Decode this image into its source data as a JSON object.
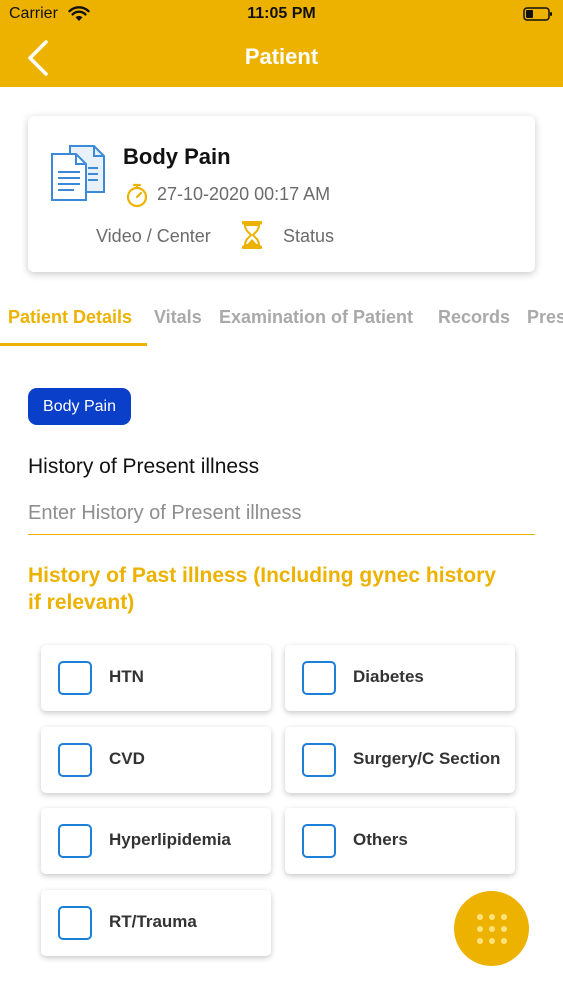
{
  "status_bar": {
    "carrier": "Carrier",
    "time": "11:05 PM"
  },
  "nav": {
    "title": "Patient"
  },
  "card": {
    "title": "Body Pain",
    "datetime": "27-10-2020 00:17 AM",
    "mode": "Video / Center",
    "status": "Status"
  },
  "tabs": [
    {
      "label": "Patient Details"
    },
    {
      "label": "Vitals"
    },
    {
      "label": "Examination of Patient"
    },
    {
      "label": "Records"
    },
    {
      "label": "Prescription"
    }
  ],
  "complaint_tag": "Body Pain",
  "history_present": {
    "label": "History of Present illness",
    "placeholder": "Enter History of Present illness",
    "value": ""
  },
  "history_past": {
    "heading": "History of Past illness (Including gynec history if relevant)",
    "options": [
      {
        "label": "HTN",
        "checked": false
      },
      {
        "label": "Diabetes",
        "checked": false
      },
      {
        "label": "CVD",
        "checked": false
      },
      {
        "label": "Surgery/C Section",
        "checked": false
      },
      {
        "label": "Hyperlipidemia",
        "checked": false
      },
      {
        "label": "Others",
        "checked": false
      },
      {
        "label": "RT/Trauma",
        "checked": false
      }
    ]
  },
  "colors": {
    "accent": "#EDB200",
    "tag": "#0A3FC9",
    "checkbox": "#1E7FD9"
  }
}
